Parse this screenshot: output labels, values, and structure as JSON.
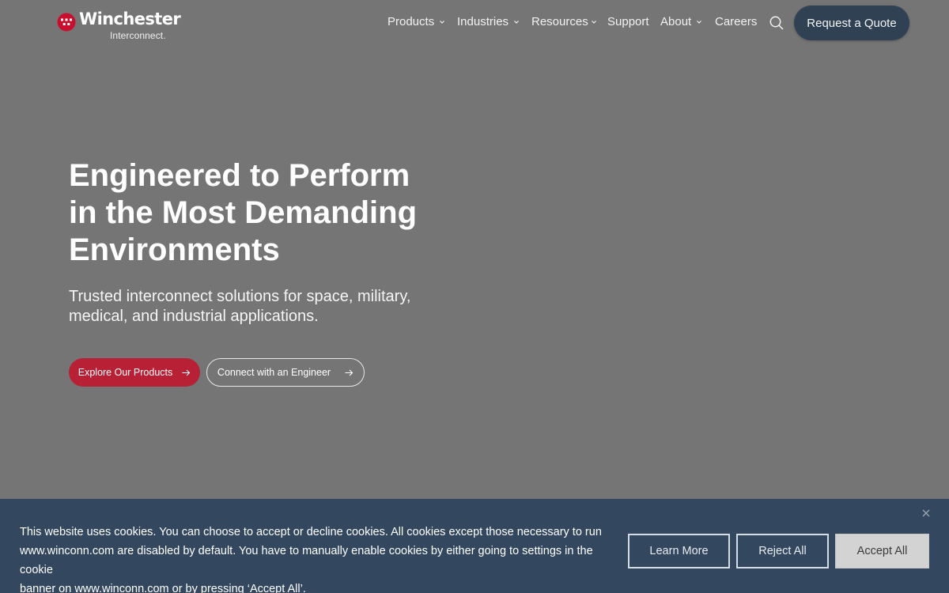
{
  "brand": {
    "name": "Winchester",
    "sub": "Interconnect.",
    "accent": "#c8102e"
  },
  "nav": {
    "items": [
      {
        "label": "Products",
        "dropdown": true
      },
      {
        "label": "Industries",
        "dropdown": true
      },
      {
        "label": "Resources",
        "dropdown": true
      },
      {
        "label": "Support",
        "dropdown": false
      },
      {
        "label": "About",
        "dropdown": true
      },
      {
        "label": "Careers",
        "dropdown": false
      }
    ],
    "search_icon": "search-icon",
    "cta_label": "Request a Quote"
  },
  "hero": {
    "title_lines": [
      "Engineered to Perform",
      "in the Most Demanding",
      "Environments"
    ],
    "subtitle_lines": [
      "Trusted interconnect solutions for space, military,",
      "medical, and industrial applications."
    ],
    "primary_cta": "Explore Our Products",
    "secondary_cta": "Connect with an Engineer"
  },
  "cookie": {
    "text_lines": [
      "This website uses cookies. You can choose to accept or decline cookies. All cookies except those necessary to run",
      "www.winconn.com are disabled by default. You have to manually enable cookies by either going to settings in the cookie",
      "banner on www.winconn.com or by pressing ‘Accept All’."
    ],
    "learn_more": "Learn More",
    "reject_all": "Reject All",
    "accept_all": "Accept All",
    "background": "#33475e"
  }
}
